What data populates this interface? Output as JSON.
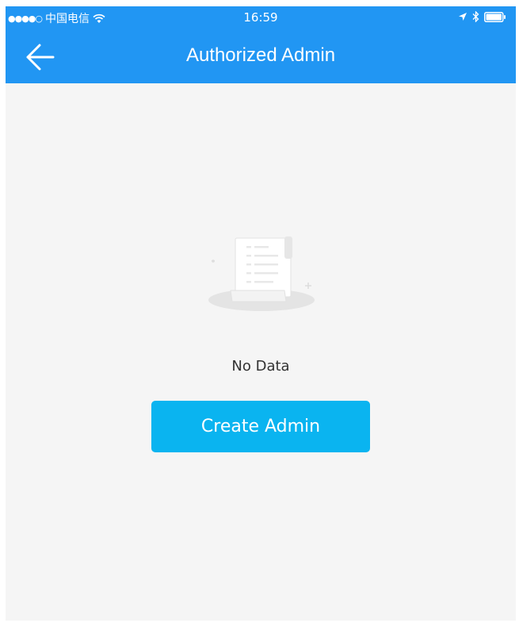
{
  "status_bar": {
    "signal": "●●●●○",
    "carrier": "中国电信",
    "time": "16:59"
  },
  "header": {
    "title": "Authorized Admin"
  },
  "empty_state": {
    "message": "No Data"
  },
  "actions": {
    "create_label": "Create Admin"
  },
  "colors": {
    "header_bg": "#2196f3",
    "button_bg": "#0ab4f0",
    "page_bg": "#f5f5f5"
  },
  "icons": {
    "back": "arrow-left-icon",
    "empty": "document-scroll-icon"
  }
}
